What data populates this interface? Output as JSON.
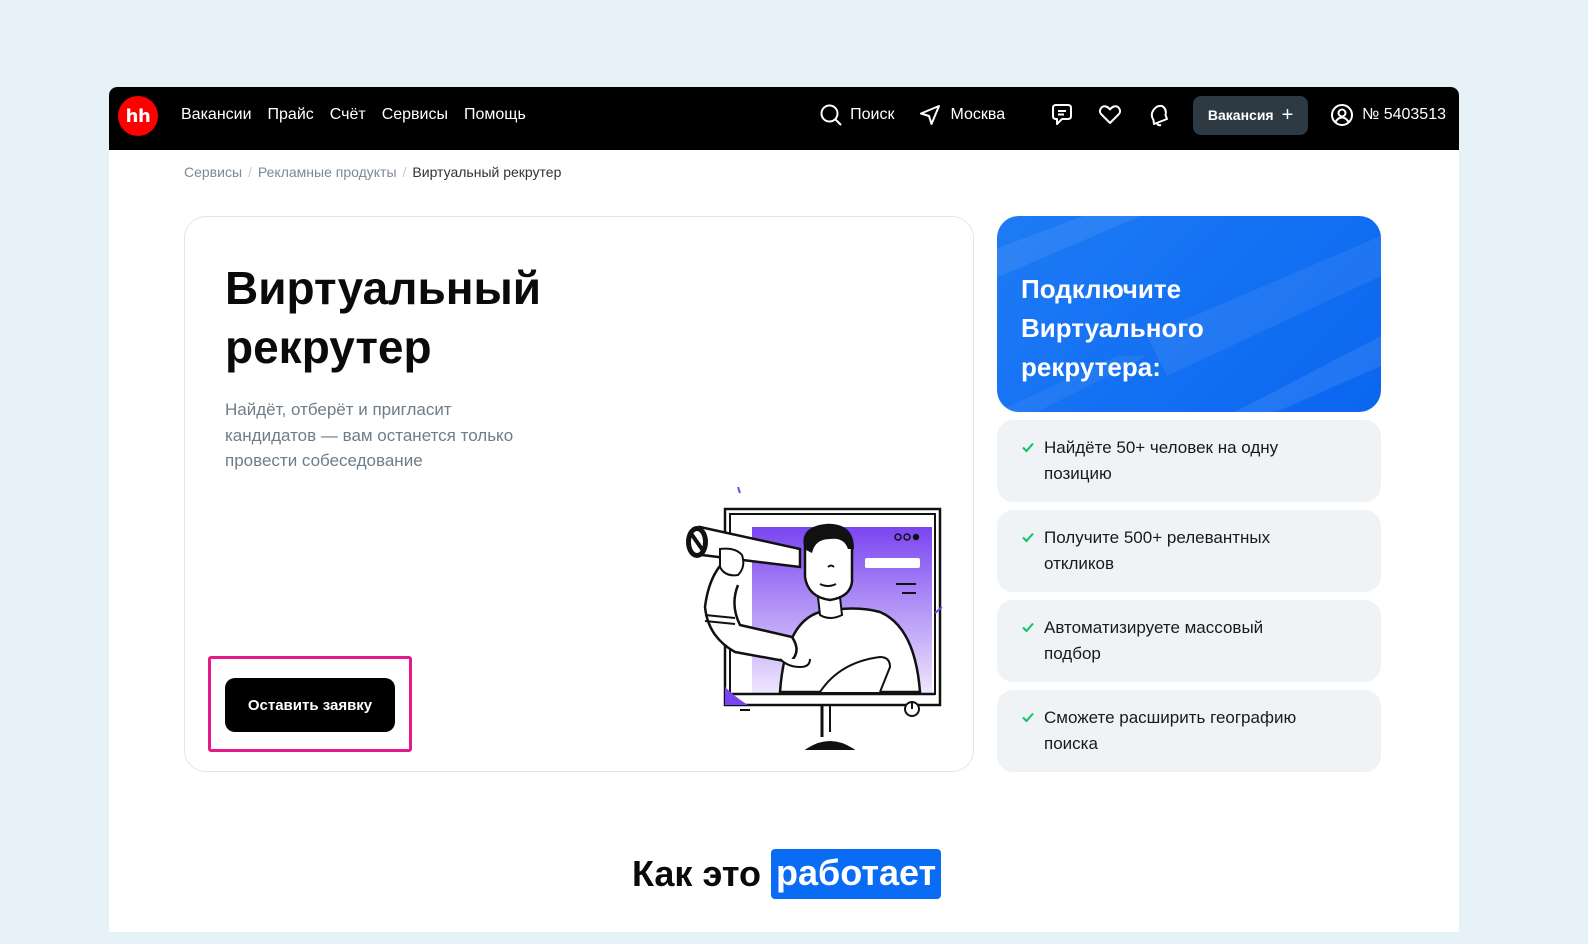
{
  "header": {
    "logo_text": "hh",
    "nav": [
      "Вакансии",
      "Прайс",
      "Счёт",
      "Сервисы",
      "Помощь"
    ],
    "search_label": "Поиск",
    "city_label": "Москва",
    "icons": [
      "chat-icon",
      "heart-icon",
      "notification-icon"
    ],
    "vacancy_button": "Вакансия",
    "vacancy_button_icon": "+",
    "account_number": "№ 5403513"
  },
  "breadcrumb": {
    "items": [
      "Сервисы",
      "Рекламные продукты"
    ],
    "current": "Виртуальный рекрутер"
  },
  "hero": {
    "title": "Виртуальный рекрутер",
    "description": "Найдёт, отберёт и пригласит кандидатов — вам останется только провести собеседование",
    "cta": "Оставить заявку"
  },
  "promo": {
    "title": "Подключите Виртуального рекрутера:"
  },
  "features": [
    "Найдёте 50+ человек на одну позицию",
    "Получите 500+ релевантных откликов",
    "Автоматизируете массовый подбор",
    "Сможете расширить географию поиска"
  ],
  "how_it_works": {
    "prefix": "Как это",
    "highlight": "работает"
  },
  "colors": {
    "brand_red": "#ff0000",
    "promo_blue": "#0a66f0",
    "highlight_border": "#e6198c",
    "check_green": "#0dc267"
  }
}
